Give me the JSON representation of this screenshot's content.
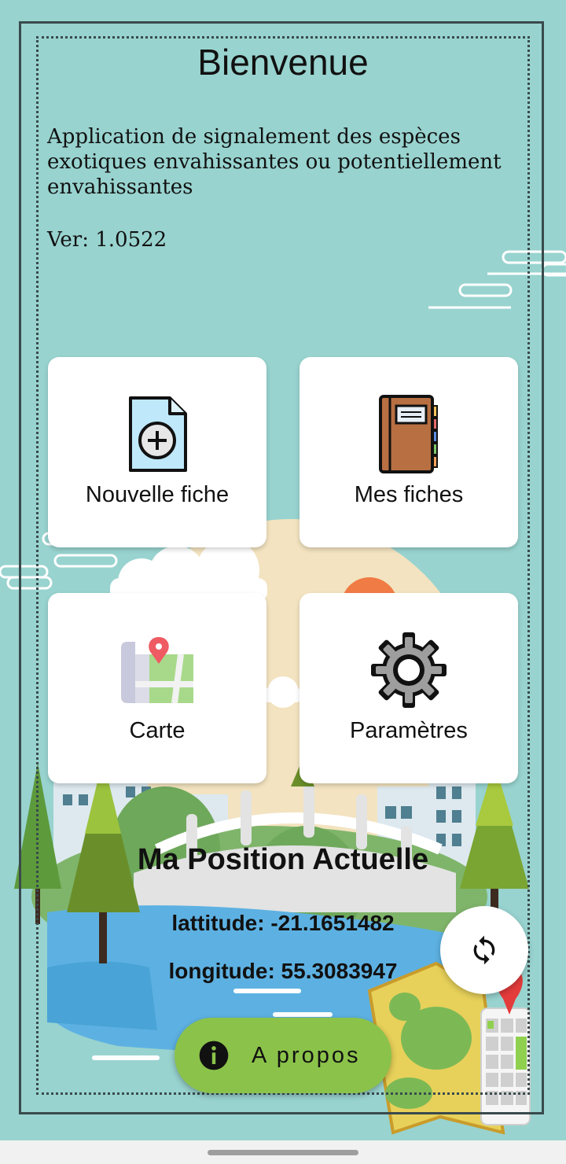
{
  "header": {
    "title": "Bienvenue",
    "description": "Application de signalement des espèces exotiques envahissantes ou potentiellement envahissantes",
    "version": "Ver: 1.0522"
  },
  "menu": {
    "new_form": "Nouvelle fiche",
    "my_forms": "Mes fiches",
    "map": "Carte",
    "settings": "Paramètres"
  },
  "position": {
    "title": "Ma Position Actuelle",
    "latitude": "lattitude: -21.1651482",
    "longitude": "longitude: 55.3083947"
  },
  "about_button": "A propos",
  "icons": {
    "new_form": "file-add-icon",
    "my_forms": "notebook-icon",
    "map": "map-pin-icon",
    "settings": "gear-icon",
    "refresh": "refresh-icon",
    "about": "info-icon"
  },
  "colors": {
    "background": "#98d3cf",
    "about_button": "#8bc34a",
    "card": "#ffffff"
  }
}
